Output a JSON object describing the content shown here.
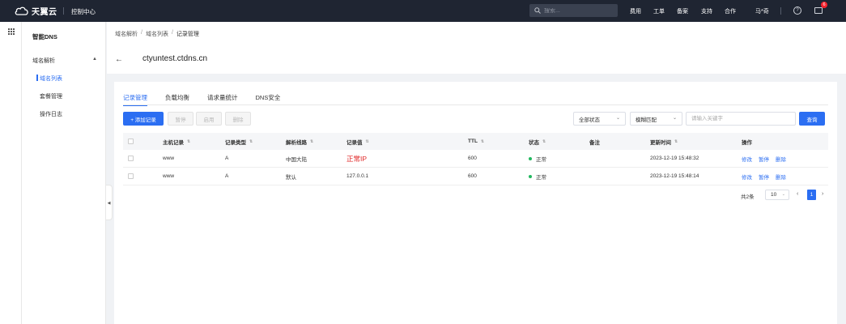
{
  "topbar": {
    "logo_text": "天翼云",
    "console_label": "控制中心",
    "search_placeholder": "搜索...",
    "nav": [
      "费用",
      "工单",
      "备案",
      "支持",
      "合作"
    ],
    "user": "马*奇",
    "mail_count": "6"
  },
  "sidebar": {
    "title": "智能DNS",
    "group_label": "域名解析",
    "items": [
      {
        "label": "域名列表",
        "active": true
      },
      {
        "label": "套餐管理",
        "active": false
      },
      {
        "label": "操作日志",
        "active": false
      }
    ]
  },
  "header": {
    "breadcrumb": [
      "域名解析",
      "域名列表",
      "记录管理"
    ],
    "separator": "/",
    "domain": "ctyuntest.ctdns.cn"
  },
  "tabs": [
    "记录管理",
    "负载均衡",
    "请求量统计",
    "DNS安全"
  ],
  "toolbar": {
    "add_label": "+ 添加记录",
    "pause_label": "暂停",
    "enable_label": "启用",
    "delete_label": "删除",
    "status_select": "全部状态",
    "match_select": "模糊匹配",
    "keyword_placeholder": "请输入关键字",
    "query_label": "查询"
  },
  "table": {
    "columns": [
      "主机记录",
      "记录类型",
      "解析线路",
      "记录值",
      "TTL",
      "状态",
      "备注",
      "更新时间",
      "操作"
    ],
    "rows": [
      {
        "host": "www",
        "type": "A",
        "line": "中国大陆",
        "value": "正常IP",
        "ttl": "600",
        "status": "正常",
        "remark": "",
        "updated": "2023-12-19 15:48:32",
        "ops": [
          "修改",
          "暂停",
          "删除"
        ]
      },
      {
        "host": "www",
        "type": "A",
        "line": "默认",
        "value": "127.0.0.1",
        "ttl": "600",
        "status": "正常",
        "remark": "",
        "updated": "2023-12-19 15:48:14",
        "ops": [
          "修改",
          "暂停",
          "删除"
        ]
      }
    ]
  },
  "pagination": {
    "total": "共2条",
    "page_size": "10",
    "current_page": "1"
  },
  "colors": {
    "primary": "#2b6ef2",
    "topbar": "#1f2532",
    "status_ok": "#22b85f",
    "record_highlight": "#e02828"
  }
}
